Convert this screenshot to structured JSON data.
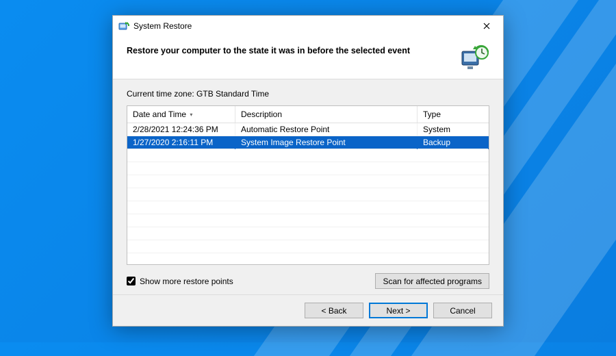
{
  "window": {
    "title": "System Restore"
  },
  "header": {
    "instruction": "Restore your computer to the state it was in before the selected event"
  },
  "tzLabel": "Current time zone: GTB Standard Time",
  "columns": {
    "date": "Date and Time",
    "desc": "Description",
    "type": "Type"
  },
  "rows": [
    {
      "date": "2/28/2021 12:24:36 PM",
      "desc": "Automatic Restore Point",
      "type": "System",
      "selected": false
    },
    {
      "date": "1/27/2020 2:16:11 PM",
      "desc": "System Image Restore Point",
      "type": "Backup",
      "selected": true
    }
  ],
  "checkbox": {
    "label": "Show more restore points",
    "checked": true
  },
  "buttons": {
    "scan": "Scan for affected programs",
    "back": "< Back",
    "next": "Next >",
    "cancel": "Cancel"
  }
}
